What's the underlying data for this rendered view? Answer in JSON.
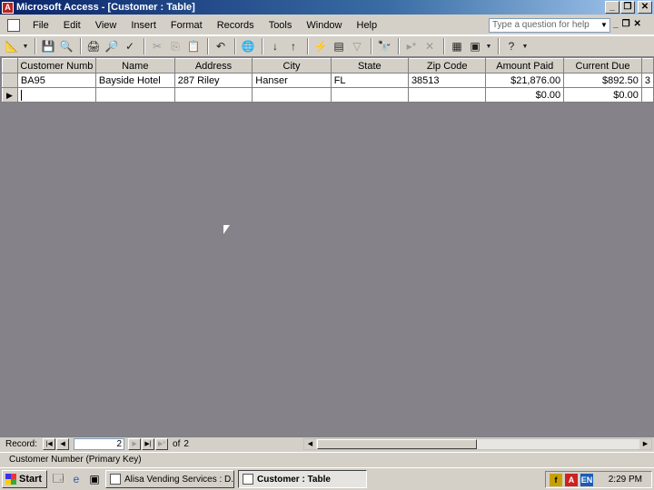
{
  "window": {
    "title": "Microsoft Access - [Customer : Table]"
  },
  "menu": {
    "items": [
      "File",
      "Edit",
      "View",
      "Insert",
      "Format",
      "Records",
      "Tools",
      "Window",
      "Help"
    ],
    "help_placeholder": "Type a question for help"
  },
  "table": {
    "columns": [
      "Customer Numb",
      "Name",
      "Address",
      "City",
      "State",
      "Zip Code",
      "Amount Paid",
      "Current Due",
      ""
    ],
    "rows": [
      [
        "BA95",
        "Bayside Hotel",
        "287 Riley",
        "Hanser",
        "FL",
        "38513",
        "$21,876.00",
        "$892.50",
        "3"
      ],
      [
        "",
        "",
        "",
        "",
        "",
        "",
        "$0.00",
        "$0.00",
        ""
      ]
    ]
  },
  "navigation": {
    "record_label": "Record:",
    "current": "2",
    "of_label": "of",
    "total": "2"
  },
  "status": {
    "text": "Customer Number (Primary Key)"
  },
  "taskbar": {
    "start": "Start",
    "tasks": [
      "Alisa Vending Services : D...",
      "Customer : Table"
    ],
    "clock": "2:29 PM",
    "tray_lang": "EN"
  },
  "colors": {
    "title_start": "#0a246a",
    "title_end": "#a6caf0",
    "workspace": "#858289"
  }
}
